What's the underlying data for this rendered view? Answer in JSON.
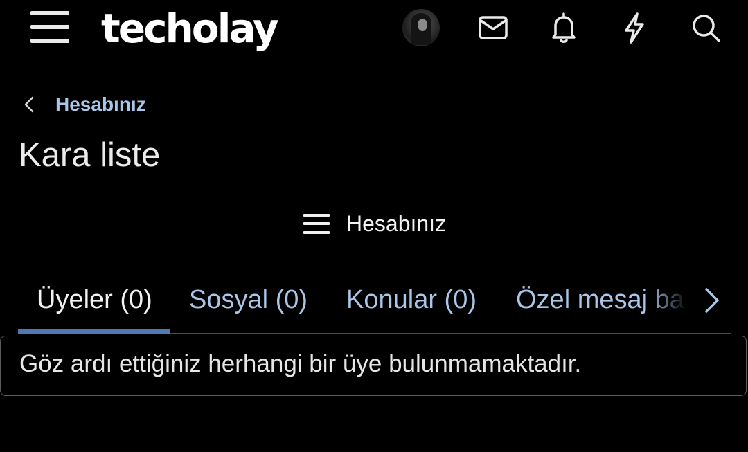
{
  "header": {
    "logo": "techolay",
    "icons": [
      "menu-icon",
      "avatar",
      "envelope-icon",
      "bell-icon",
      "lightning-icon",
      "search-icon"
    ]
  },
  "breadcrumb": {
    "label": "Hesabınız"
  },
  "page": {
    "title": "Kara liste"
  },
  "account_menu": {
    "label": "Hesabınız"
  },
  "tabs": [
    {
      "label": "Üyeler (0)",
      "active": true
    },
    {
      "label": "Sosyal (0)",
      "active": false
    },
    {
      "label": "Konular (0)",
      "active": false
    },
    {
      "label": "Özel mesaj ba",
      "active": false
    }
  ],
  "content": {
    "empty_message": "Göz ardı ettiğiniz herhangi bir üye bulunmamaktadır."
  },
  "colors": {
    "background": "#000000",
    "link": "#a9c5e8",
    "tab_active_underline": "#4f79b0"
  }
}
